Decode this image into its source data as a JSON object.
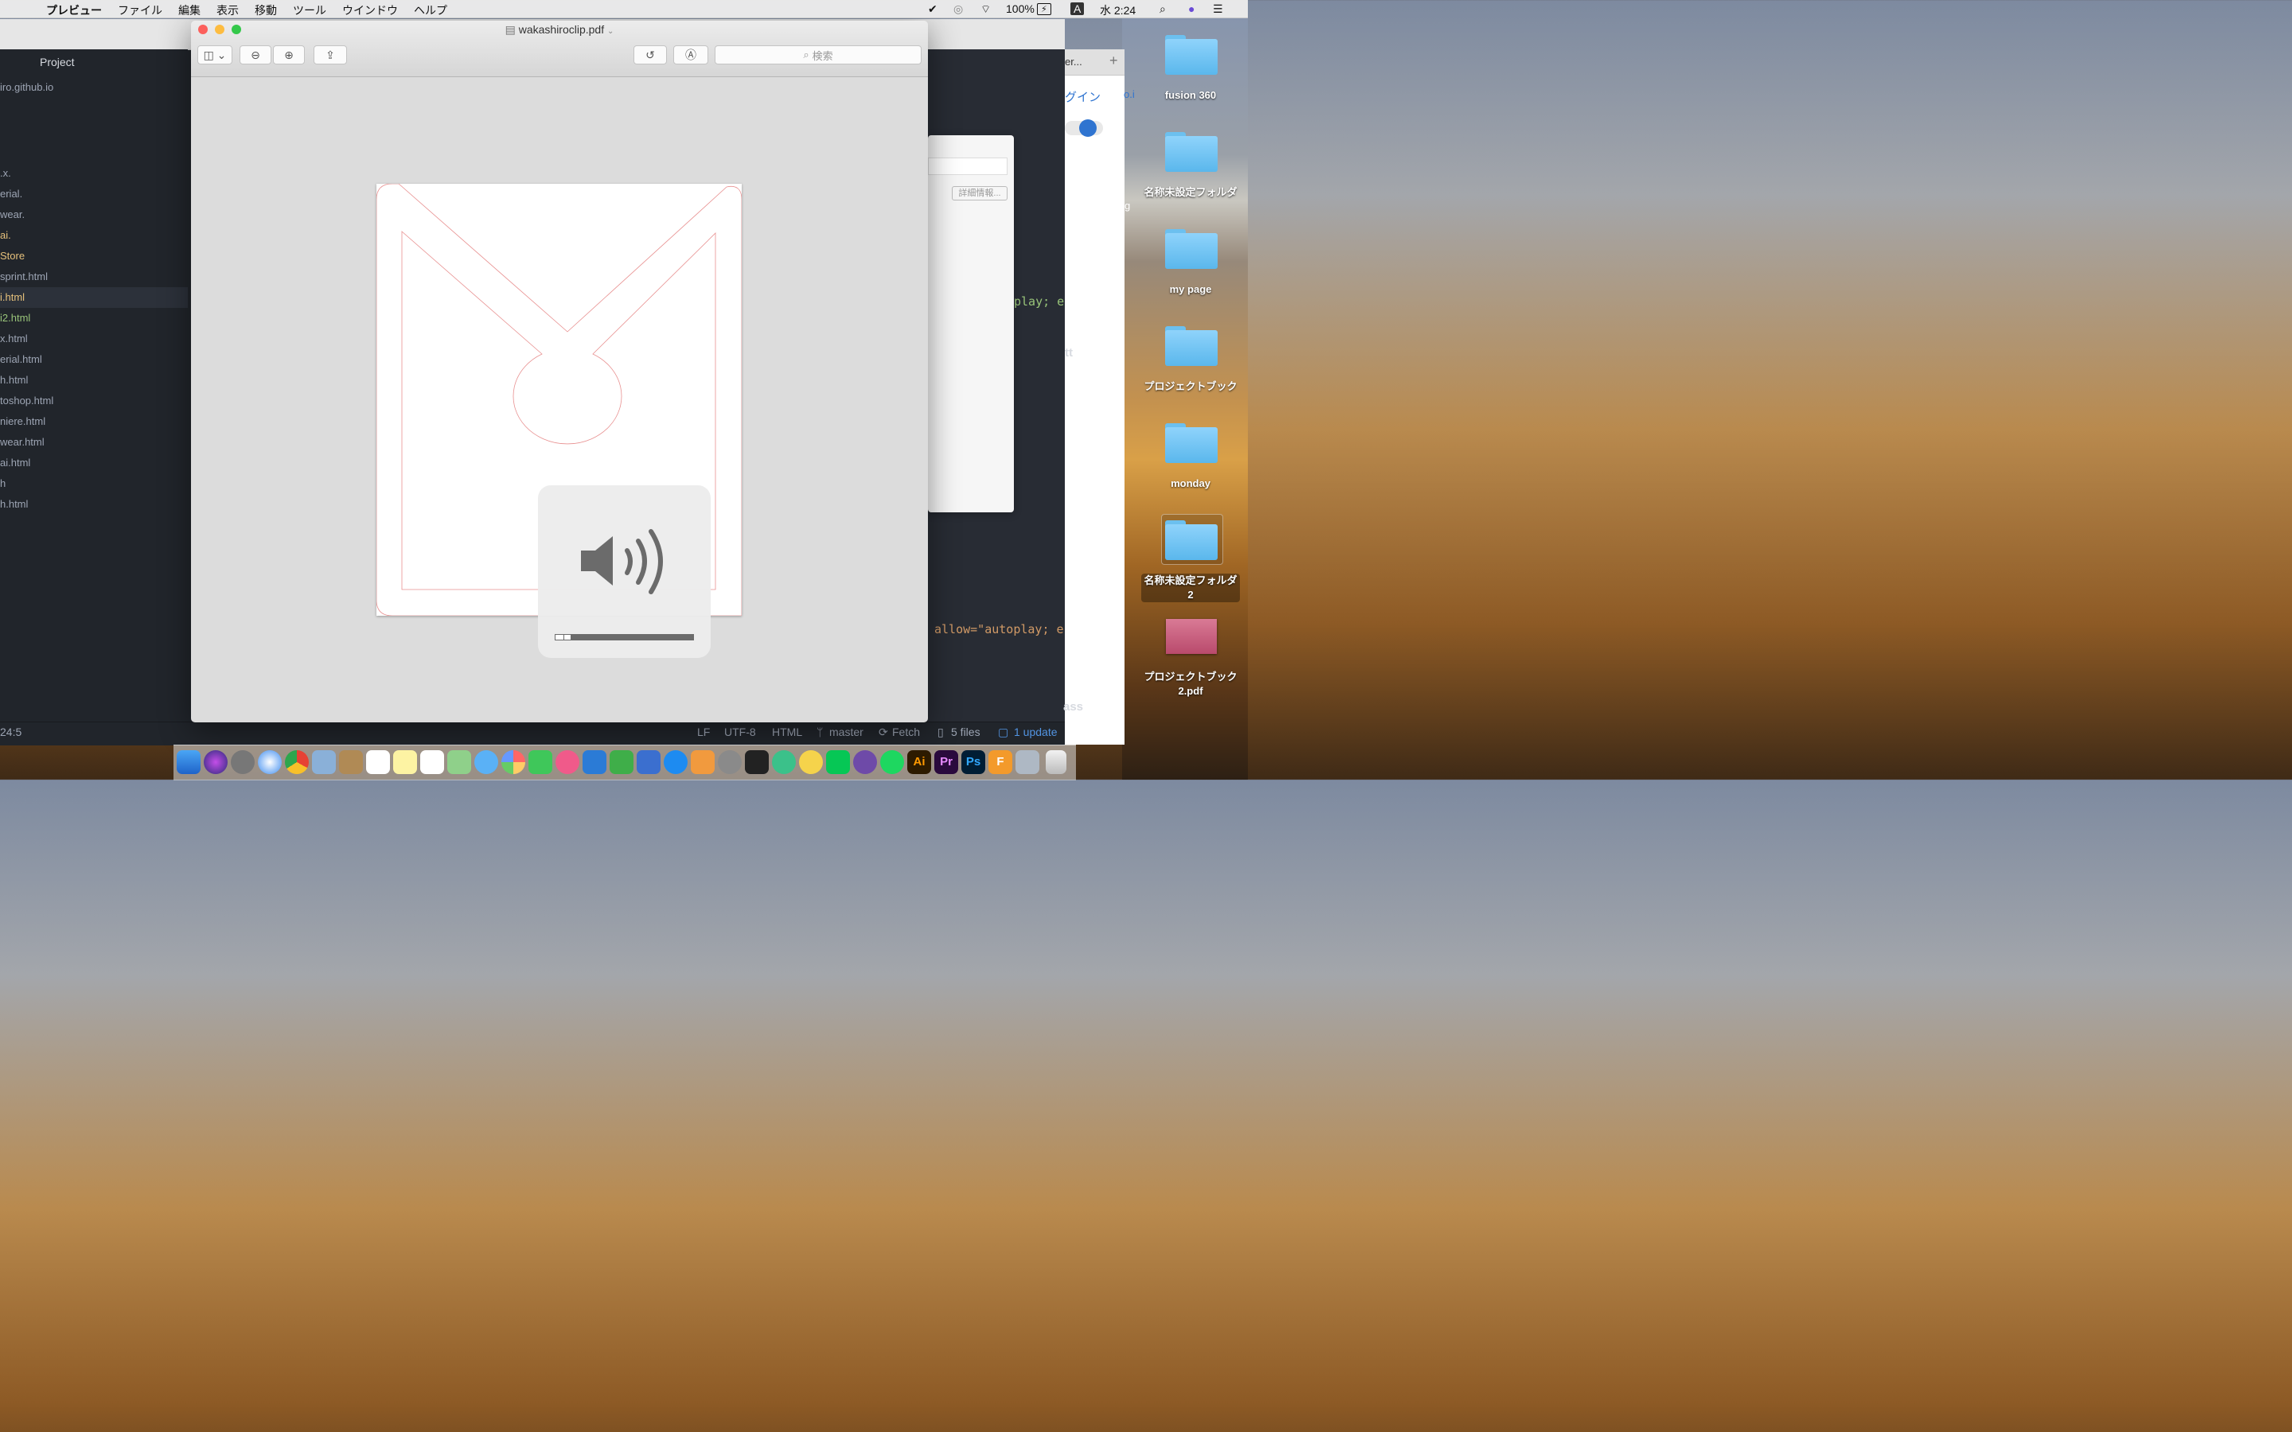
{
  "menubar": {
    "app": "プレビュー",
    "items": [
      "ファイル",
      "編集",
      "表示",
      "移動",
      "ツール",
      "ウインドウ",
      "ヘルプ"
    ],
    "battery": "100%",
    "input": "A",
    "clock": "水 2:24"
  },
  "editor": {
    "tree_title": "Project",
    "root": "iro.github.io",
    "rows": [
      ".x.",
      "erial.",
      "wear.",
      "ai.",
      "Store",
      "sprint.html",
      "i.html",
      "i2.html",
      "x.html",
      "erial.html",
      "h.html",
      "toshop.html",
      "niere.html",
      "wear.html",
      "ai.html",
      "h",
      "h.html"
    ],
    "code_fragments": [
      "play; e",
      "tt",
      "allow=\"autoplay; e",
      "ass"
    ],
    "status": {
      "cursor": "24:5",
      "eol": "LF",
      "encoding": "UTF-8",
      "grammar": "HTML",
      "branch": "master",
      "fetch": "Fetch",
      "files": "5 files",
      "update": "1 update"
    }
  },
  "browser": {
    "tab_fragment": "er...",
    "link_fragment": "グイン",
    "fragment2": "o.i",
    "fragment3": "g",
    "dialog_button": "詳細情報..."
  },
  "preview": {
    "title": "wakashiroclip.pdf",
    "search_placeholder": "検索"
  },
  "volume": {
    "level": 0.1
  },
  "desktop": {
    "items": [
      "fusion 360",
      "名称未設定フォルダ",
      "my page",
      "プロジェクトブック",
      "monday",
      "名称未設定フォルダ 2",
      "プロジェクトブック 2.pdf"
    ]
  },
  "colors": {
    "accent": "#2f74d0",
    "cut_line": "#e89090",
    "editor_bg": "#21252b"
  }
}
